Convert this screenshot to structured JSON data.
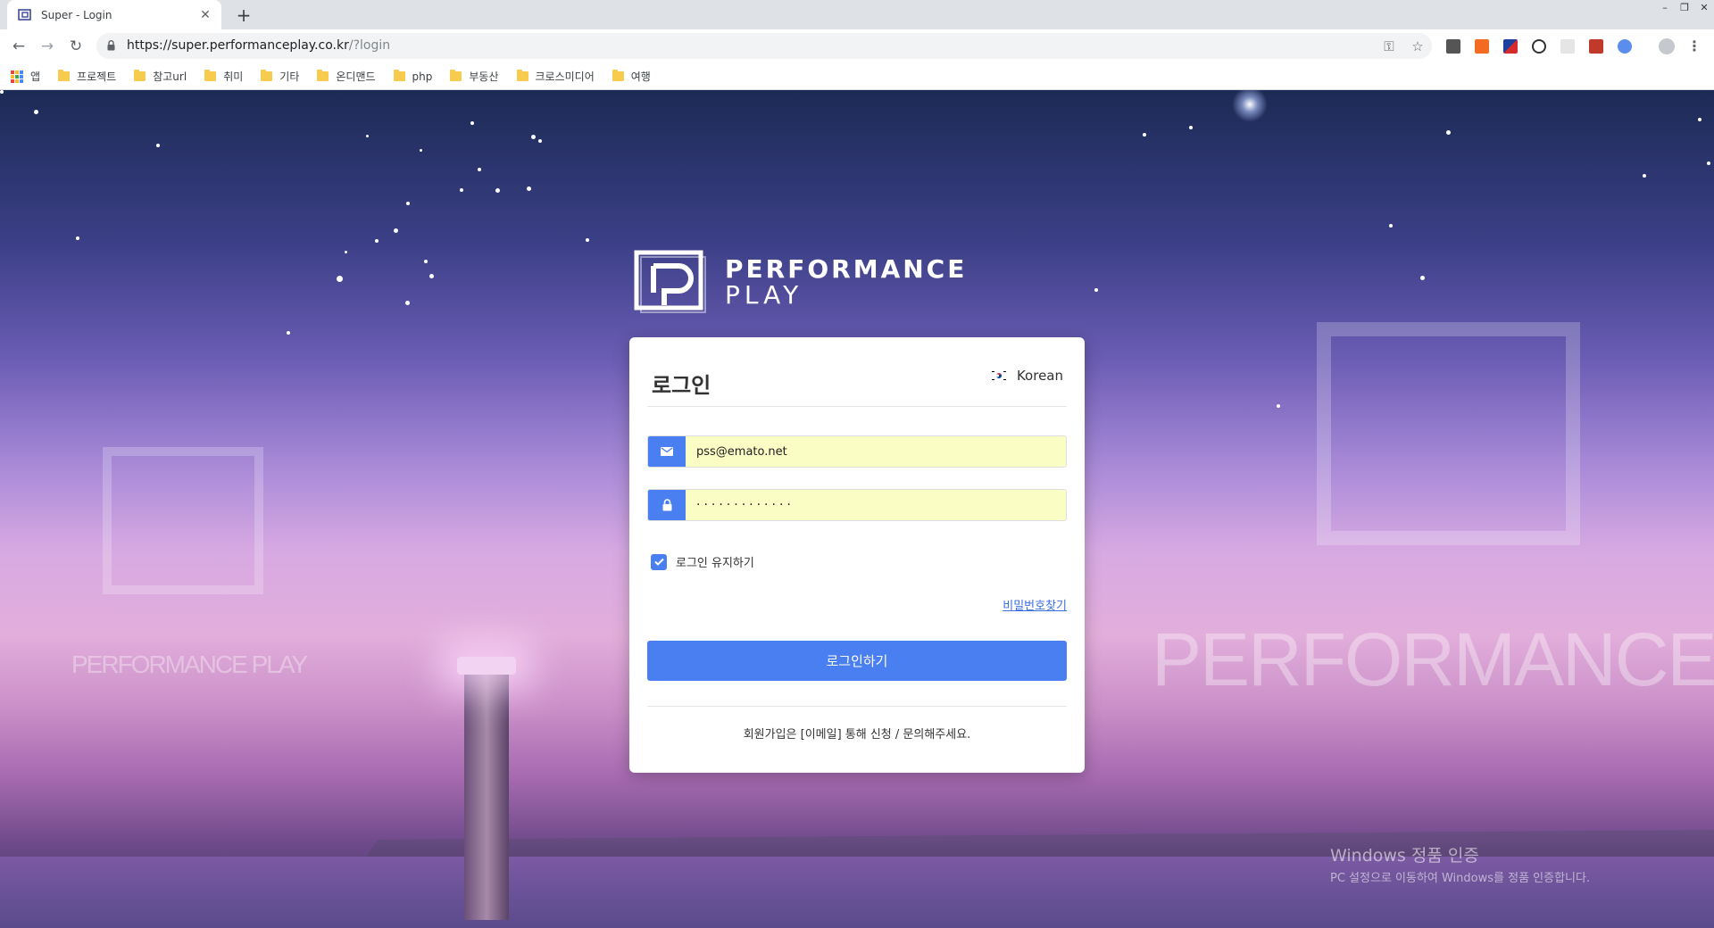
{
  "browser": {
    "tab_title": "Super - Login",
    "tab_close": "✕",
    "new_tab": "+",
    "url_host": "https://super.performanceplay.co.kr",
    "url_path": "/?login",
    "window_controls": [
      "–",
      "❐",
      "✕"
    ],
    "bookmarks": [
      "앱",
      "프로젝트",
      "참고url",
      "취미",
      "기타",
      "온디맨드",
      "php",
      "부동산",
      "크로스미디어",
      "여행"
    ]
  },
  "brand": {
    "line1": "PERFORMANCE",
    "line2": "PLAY"
  },
  "background": {
    "text_left": "PERFORMANCE PLAY",
    "text_right": "PERFORMANCE"
  },
  "login": {
    "title": "로그인",
    "language": "Korean",
    "email_value": "pss@emato.net",
    "password_value": "·············",
    "remember_label": "로그인 유지하기",
    "remember_checked": true,
    "find_password": "비밀번호찾기",
    "submit_label": "로그인하기",
    "signup_note": "회원가입은 [이메일] 통해 신청 / 문의해주세요."
  },
  "os_watermark": {
    "title": "Windows 정품 인증",
    "subtitle": "PC 설정으로 이동하여 Windows를 정품 인증합니다."
  },
  "colors": {
    "accent": "#4a7ff2",
    "input_autofill": "#fafdc4"
  }
}
